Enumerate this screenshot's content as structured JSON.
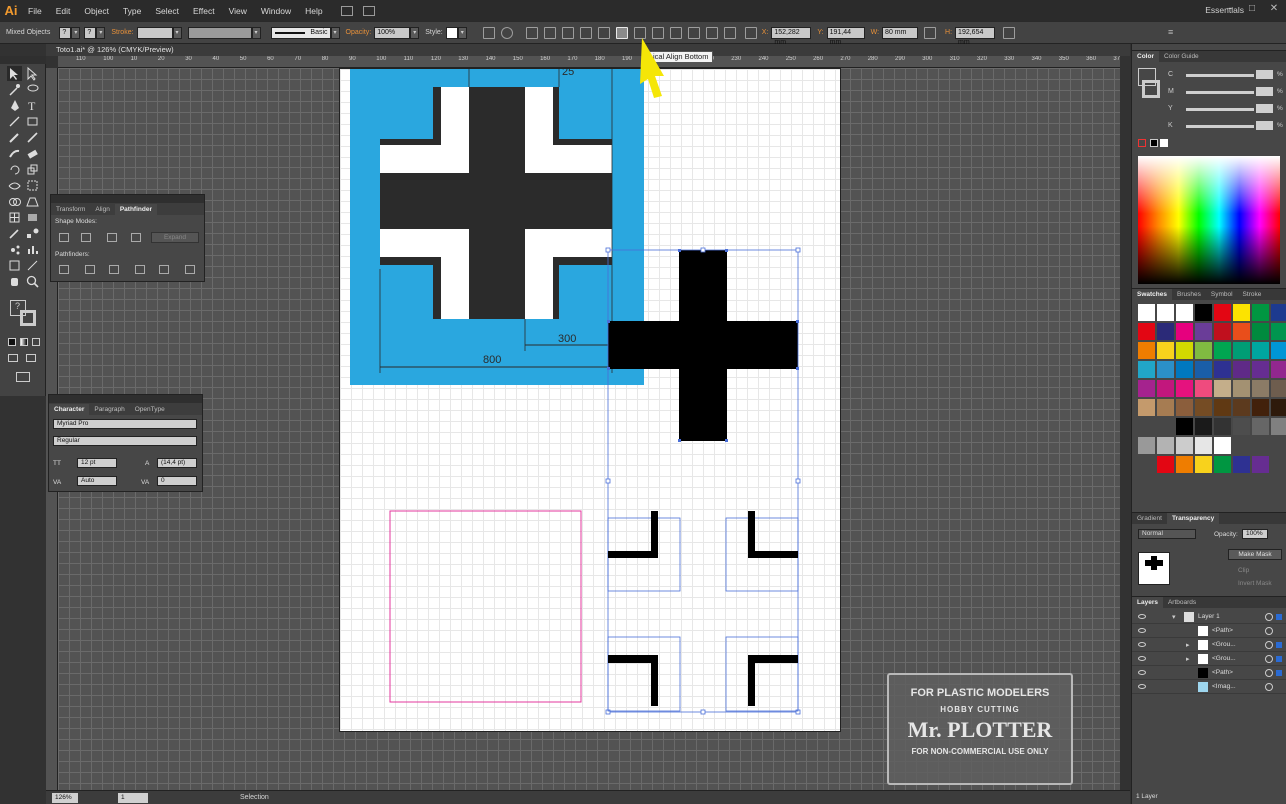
{
  "menubar": {
    "logo": "Ai",
    "items": [
      "File",
      "Edit",
      "Object",
      "Type",
      "Select",
      "Effect",
      "View",
      "Window",
      "Help"
    ],
    "workspace": "Essentials"
  },
  "controlbar": {
    "selection_label": "Mixed Objects",
    "stroke_label": "Stroke:",
    "stroke_profile": "Basic",
    "opacity_label": "Opacity:",
    "opacity_value": "100%",
    "style_label": "Style:",
    "x_label": "X:",
    "x_value": "152,282 mm",
    "y_label": "Y:",
    "y_value": "191,44 mm",
    "w_label": "W:",
    "w_value": "80 mm",
    "h_label": "H:",
    "h_value": "192,654 mm"
  },
  "document": {
    "tab_title": "Toto1.ai* @ 126% (CMYK/Preview)",
    "ruler_top": [
      "110",
      "100",
      "10",
      "20",
      "30",
      "40",
      "50",
      "60",
      "70",
      "80",
      "90",
      "100",
      "110",
      "120",
      "130",
      "140",
      "150",
      "160",
      "170",
      "180",
      "190",
      "200",
      "210",
      "220",
      "230",
      "240",
      "250",
      "260",
      "270",
      "280",
      "290",
      "300",
      "310",
      "320",
      "330",
      "340",
      "350",
      "360",
      "370",
      "380",
      "390",
      "400"
    ],
    "zoom": "126%",
    "artboard_number": "1",
    "status_text": "Selection"
  },
  "tooltip": {
    "text": "ical Align Bottom"
  },
  "artwork": {
    "dim_800": "800",
    "dim_300": "300",
    "dim_25": "25"
  },
  "pathfinder_panel": {
    "tabs": [
      "Transform",
      "Align",
      "Pathfinder"
    ],
    "active_tab": "Pathfinder",
    "shape_modes_label": "Shape Modes:",
    "expand_label": "Expand",
    "pathfinders_label": "Pathfinders:"
  },
  "character_panel": {
    "tabs": [
      "Character",
      "Paragraph",
      "OpenType"
    ],
    "font_family": "Myriad Pro",
    "font_style": "Regular",
    "font_size": "12 pt",
    "leading": "(14,4 pt)",
    "kerning": "Auto",
    "tracking": "0"
  },
  "color_panel": {
    "tabs": [
      "Color",
      "Color Guide"
    ],
    "channels": [
      {
        "label": "C",
        "value": ""
      },
      {
        "label": "M",
        "value": ""
      },
      {
        "label": "Y",
        "value": ""
      },
      {
        "label": "K",
        "value": ""
      }
    ],
    "percent": "%"
  },
  "swatches_panel": {
    "tabs": [
      "Swatches",
      "Brushes",
      "Symbol",
      "Stroke"
    ],
    "rows": [
      [
        "#ffffff",
        "#ffffff",
        "#ffffff",
        "#000000",
        "#e30613",
        "#fce300",
        "#009641",
        "#1d3a8f"
      ],
      [
        "#e30613",
        "#2b2a78",
        "#e6007e",
        "#6a3d98",
        "#c0101e",
        "#e94e1b",
        "#008a3e",
        "#00954f"
      ],
      [
        "#ef7d00",
        "#f8d21c",
        "#d2d900",
        "#80bb41",
        "#00a651",
        "#009d75",
        "#00a6a0",
        "#0096d6"
      ],
      [
        "#21a6c8",
        "#2b90c8",
        "#0078bf",
        "#1a5ea8",
        "#2e3192",
        "#5f2a87",
        "#662d91",
        "#92278f"
      ],
      [
        "#a5238e",
        "#c2177d",
        "#e5127e",
        "#ef4b7e",
        "#c4ae8a",
        "#a39172",
        "#8b7b66",
        "#6e5d4e"
      ],
      [
        "#c49a6c",
        "#a67c52",
        "#8b5e3c",
        "#754c24",
        "#603913",
        "#5c3a1e",
        "#42210b",
        "#2e1a0b"
      ]
    ],
    "gray_row": [
      "#000000",
      "#1a1a1a",
      "#333333",
      "#4d4d4d",
      "#666666",
      "#808080"
    ],
    "gray_row2": [
      "#999999",
      "#b3b3b3",
      "#cccccc",
      "#e6e6e6",
      "#ffffff"
    ],
    "bottom_row": [
      "#e30613",
      "#ef7d00",
      "#f8d21c",
      "#009641",
      "#2e3192",
      "#662d91"
    ]
  },
  "transparency_panel": {
    "tabs": [
      "Gradient",
      "Transparency"
    ],
    "blend_mode": "Normal",
    "opacity_label": "Opacity:",
    "opacity_value": "100%",
    "make_mask": "Make Mask",
    "clip": "Clip",
    "invert_mask": "Invert Mask"
  },
  "layers_panel": {
    "tabs": [
      "Layers",
      "Artboards"
    ],
    "layers": [
      {
        "name": "Layer 1"
      },
      {
        "name": "<Path>"
      },
      {
        "name": "<Grou..."
      },
      {
        "name": "<Grou..."
      },
      {
        "name": "<Path>"
      },
      {
        "name": "<Imag..."
      }
    ],
    "count": "1 Layer"
  },
  "watermark": {
    "line1": "FOR PLASTIC MODELERS",
    "line2": "HOBBY CUTTING",
    "line3": "Mr. PLOTTER",
    "line4": "FOR NON-COMMERCIAL USE ONLY"
  },
  "colors": {
    "blue_panel": "#2aa7df",
    "cross_dark": "#2b2b2b",
    "selection": "#4a6fd8",
    "pink_rect": "#e3379e",
    "pointer_yellow": "#f5e607",
    "ui_bg": "#323232"
  }
}
